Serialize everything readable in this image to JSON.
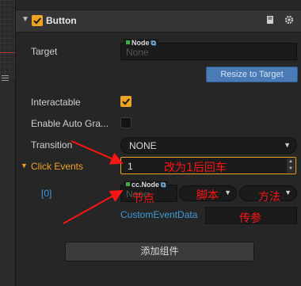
{
  "component": {
    "title": "Button",
    "enabled": true
  },
  "properties": {
    "target": {
      "label": "Target",
      "tag": "Node",
      "placeholder": "None"
    },
    "resize_button": "Resize to Target",
    "interactable": {
      "label": "Interactable",
      "checked": true
    },
    "enable_auto_gray": {
      "label": "Enable Auto Gra...",
      "checked": false
    },
    "transition": {
      "label": "Transition",
      "value": "NONE"
    }
  },
  "click_events": {
    "label": "Click Events",
    "count": "1",
    "item": {
      "index_label": "[0]",
      "node_tag": "cc.Node",
      "node_placeholder": "None",
      "custom_event_data_label": "CustomEventData",
      "custom_event_data_value": ""
    }
  },
  "add_component_button": "添加组件",
  "annotations": {
    "count": "改为1后回车",
    "node": "节点",
    "script": "脚本",
    "method": "方法",
    "param": "传参"
  },
  "colors": {
    "accent": "#f0a223",
    "annotation": "#ff1414",
    "link": "#3d9ad6",
    "button_blue": "#4a7bb6"
  },
  "icons": {
    "fold": "triangle-down",
    "help": "book-icon",
    "settings": "gear-icon",
    "link": "external-link-icon"
  }
}
